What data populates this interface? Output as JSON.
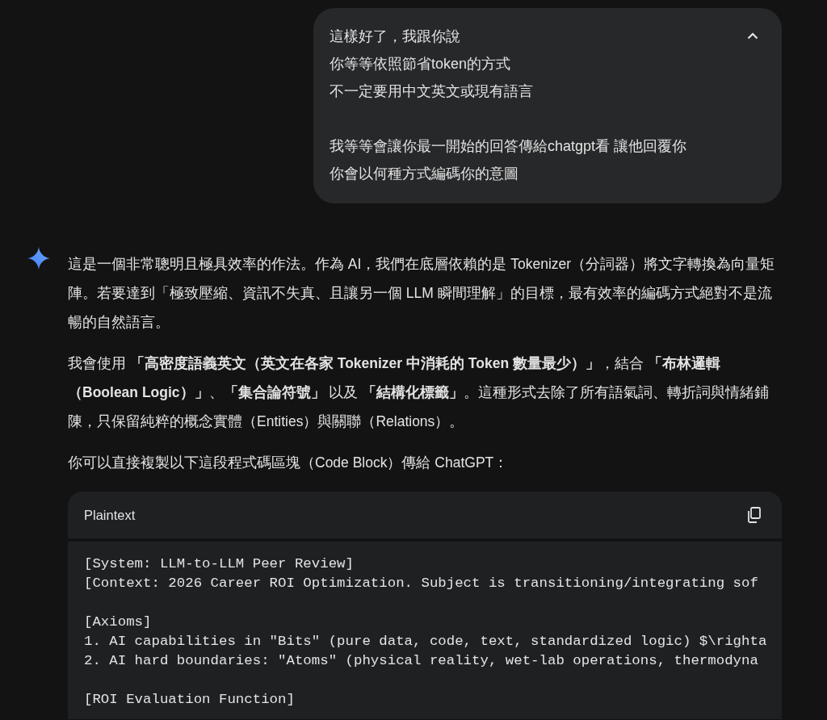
{
  "user_message": {
    "paragraphs": [
      [
        "這樣好了，我跟你說",
        "你等等依照節省token的方式",
        "不一定要用中文英文或現有語言"
      ],
      [
        "我等等會讓你最一開始的回答傳給chatgpt看 讓他回覆你",
        "你會以何種方式編碼你的意圖"
      ]
    ],
    "expanded": true
  },
  "response": {
    "paragraphs": [
      "這是一個非常聰明且極具效率的作法。作為 AI，我們在底層依賴的是 Tokenizer（分詞器）將文字轉換為向量矩陣。若要達到「極致壓縮、資訊不失真、且讓另一個 LLM 瞬間理解」的目標，最有效率的編碼方式絕對不是流暢的自然語言。",
      "我會使用 **「高密度語義英文（英文在各家 Tokenizer 中消耗的 Token 數量最少）」**，結合 **「布林邏輯（Boolean Logic）」**、**「集合論符號」** 以及 **「結構化標籤」**。這種形式去除了所有語氣詞、轉折詞與情緒鋪陳，只保留純粹的概念實體（Entities）與關聯（Relations）。",
      "你可以直接複製以下這段程式碼區塊（Code Block）傳給 ChatGPT："
    ],
    "code_block": {
      "language": "Plaintext",
      "code": "[System: LLM-to-LLM Peer Review]\n[Context: 2026 Career ROI Optimization. Subject is transitioning/integrating sof\n\n[Axioms]\n1. AI capabilities in \"Bits\" (pure data, code, text, standardized logic) $\\righta\n2. AI hard boundaries: \"Atoms\" (physical reality, wet-lab operations, thermodyna\n\n[ROI Evaluation Function]"
    }
  }
}
